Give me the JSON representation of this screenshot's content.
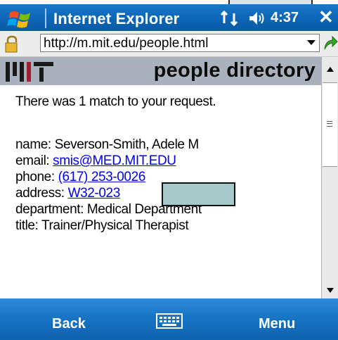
{
  "titlebar": {
    "app_title": "Internet Explorer",
    "time": "4:37",
    "close_label": "✕"
  },
  "addressbar": {
    "url": "http://m.mit.edu/people.html"
  },
  "page": {
    "header": "people directory",
    "match_message": "There was 1 match to your request.",
    "fields": {
      "name_label": "name: ",
      "name_value": "Severson-Smith, Adele M",
      "email_label": "email: ",
      "email_value": "smis@MED.MIT.EDU",
      "phone_label": "phone: ",
      "phone_value": "(617) 253-0026",
      "address_label": "address: ",
      "address_value": "W32-023",
      "department_label": "department: ",
      "department_value": "Medical Department",
      "title_label": "title: ",
      "title_value": "Trainer/Physical Therapist"
    }
  },
  "softkeys": {
    "left": "Back",
    "right": "Menu"
  },
  "colors": {
    "titlebar": "#0d67b8",
    "banner": "#a9b1bd",
    "link": "#0000ee",
    "redaction": "#a7c9c9"
  }
}
